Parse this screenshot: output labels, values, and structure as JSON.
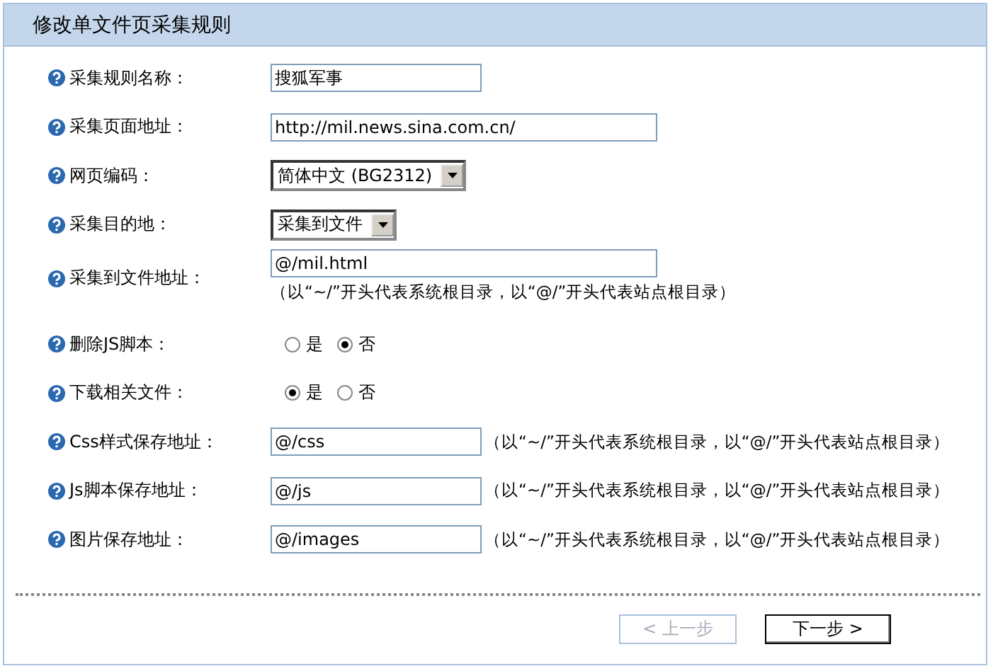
{
  "panel": {
    "title": "修改单文件页采集规则"
  },
  "fields": [
    {
      "kind": "short_text",
      "label": "采集规则名称：",
      "value": "搜狐军事"
    },
    {
      "kind": "long_text",
      "label": "采集页面地址：",
      "value": "http://mil.news.sina.com.cn/"
    },
    {
      "kind": "select",
      "label": "网页编码：",
      "value": "简体中文 (BG2312)"
    },
    {
      "kind": "select",
      "label": "采集目的地：",
      "value": "采集到文件"
    },
    {
      "kind": "long_text_note_below",
      "label": "采集到文件地址：",
      "value": "@/mil.html",
      "hint": "（以“~/”开头代表系统根目录，以“@/”开头代表站点根目录）"
    },
    {
      "kind": "radio",
      "label": "删除JS脚本：",
      "options": [
        {
          "label": "是",
          "selected": false
        },
        {
          "label": "否",
          "selected": true
        }
      ]
    },
    {
      "kind": "radio",
      "label": "下载相关文件：",
      "options": [
        {
          "label": "是",
          "selected": true
        },
        {
          "label": "否",
          "selected": false
        }
      ]
    },
    {
      "kind": "short_text_note_beside",
      "label": "Css样式保存地址：",
      "value": "@/css",
      "hint": "（以“~/”开头代表系统根目录，以“@/”开头代表站点根目录）"
    },
    {
      "kind": "short_text_note_beside",
      "label": "Js脚本保存地址：",
      "value": "@/js",
      "hint": "（以“~/”开头代表系统根目录，以“@/”开头代表站点根目录）"
    },
    {
      "kind": "short_text_note_beside",
      "label": "图片保存地址：",
      "value": "@/images",
      "hint": "（以“~/”开头代表系统根目录，以“@/”开头代表站点根目录）"
    }
  ],
  "buttons": [
    {
      "label": "< 上一步",
      "disabled": true
    },
    {
      "label": "下一步 >",
      "disabled": false
    }
  ]
}
